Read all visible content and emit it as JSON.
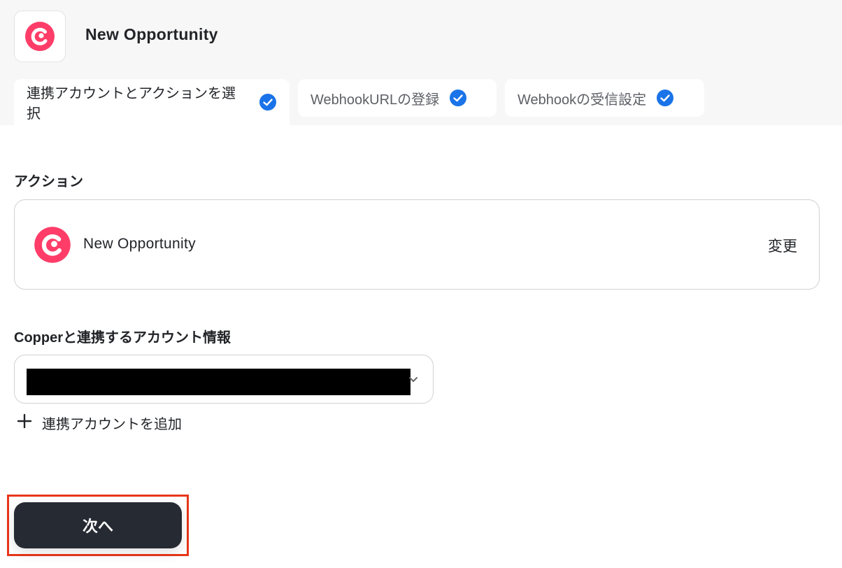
{
  "header": {
    "title": "New Opportunity",
    "app_icon": "copper-logo"
  },
  "tabs": [
    {
      "label": "連携アカウントとアクションを選択",
      "completed": true,
      "active": true
    },
    {
      "label": "WebhookURLの登録",
      "completed": true,
      "active": false
    },
    {
      "label": "Webhookの受信設定",
      "completed": true,
      "active": false
    }
  ],
  "action_section": {
    "label": "アクション",
    "action_name": "New Opportunity",
    "change_label": "変更"
  },
  "account_section": {
    "label": "Copperと連携するアカウント情報",
    "add_account_label": "連携アカウントを追加"
  },
  "next_button": {
    "label": "次へ"
  },
  "colors": {
    "brand": "#ff3d68",
    "check": "#1a73e8",
    "button_bg": "#262a33",
    "highlight": "#e8361a"
  }
}
